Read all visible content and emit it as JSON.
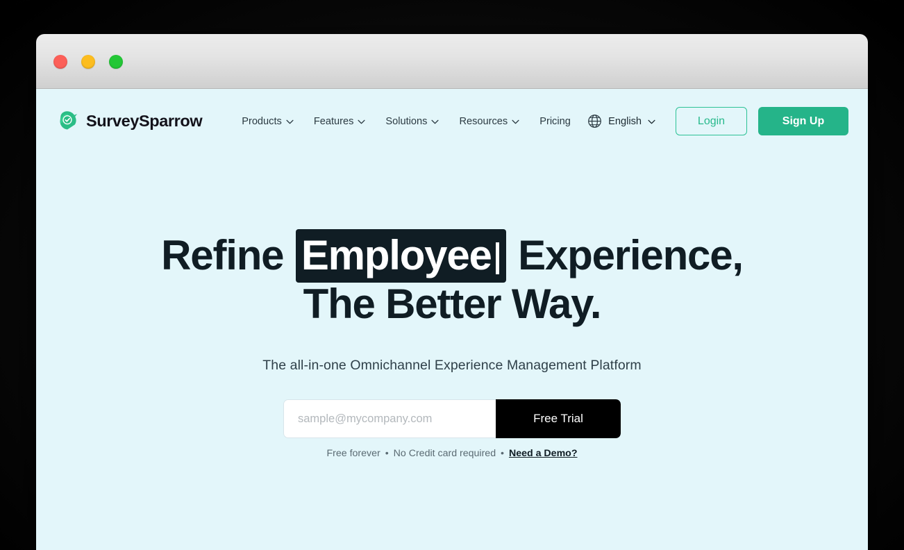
{
  "window": {
    "traffic_lights": [
      {
        "name": "close",
        "color": "#fc5f58"
      },
      {
        "name": "minimize",
        "color": "#fcbd20"
      },
      {
        "name": "maximize",
        "color": "#23c736"
      }
    ]
  },
  "navbar": {
    "brand": {
      "name": "SurveySparrow",
      "logo_icon": "sparrow-check-logo",
      "logo_color": "#2bbd86"
    },
    "items": [
      {
        "label": "Products",
        "has_dropdown": true
      },
      {
        "label": "Features",
        "has_dropdown": true
      },
      {
        "label": "Solutions",
        "has_dropdown": true
      },
      {
        "label": "Resources",
        "has_dropdown": true
      },
      {
        "label": "Pricing",
        "has_dropdown": false
      }
    ],
    "language": {
      "icon": "globe-icon",
      "label": "English",
      "has_dropdown": true
    },
    "login_label": "Login",
    "signup_label": "Sign Up",
    "accent_color": "#25b489"
  },
  "hero": {
    "heading_prefix": "Refine",
    "typed_word": "Employee",
    "heading_suffix": "Experience,",
    "heading_line_2": "The Better Way.",
    "highlight_bg": "#101d24",
    "subtitle": "The all-in-one Omnichannel Experience Management Platform"
  },
  "signup_form": {
    "email_placeholder": "sample@mycompany.com",
    "email_value": "",
    "cta_label": "Free Trial",
    "footnote_part_1": "Free forever",
    "bullet": "•",
    "footnote_part_2": "No Credit card required",
    "demo_link": "Need a Demo?"
  }
}
